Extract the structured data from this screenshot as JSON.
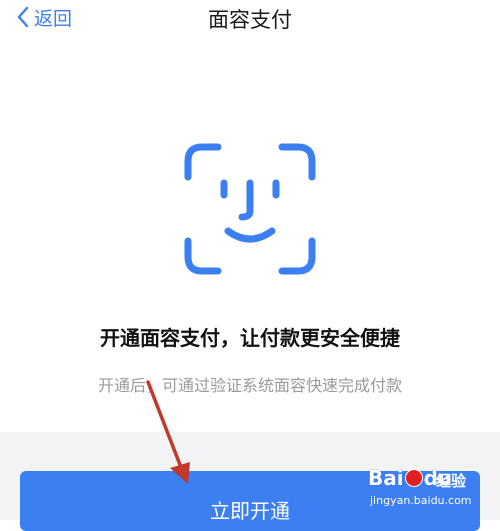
{
  "navbar": {
    "back_label": "返回",
    "title": "面容支付"
  },
  "icons": {
    "back": "chevron-left-icon",
    "face": "face-id-icon"
  },
  "content": {
    "headline": "开通面容支付，让付款更安全便捷",
    "subtext": "开通后，可通过验证系统面容快速完成付款"
  },
  "action": {
    "enable_label": "立即开通"
  },
  "watermark": {
    "logo_text_1": "Bai",
    "logo_text_2": "du",
    "product": "经验",
    "url": "jingyan.baidu.com"
  },
  "colors": {
    "accent": "#3b7ff2",
    "annotation_arrow": "#c0392b",
    "title_text": "#1a1a1a",
    "secondary_text": "#9a9a9a",
    "bottom_background": "#f4f4f6"
  }
}
